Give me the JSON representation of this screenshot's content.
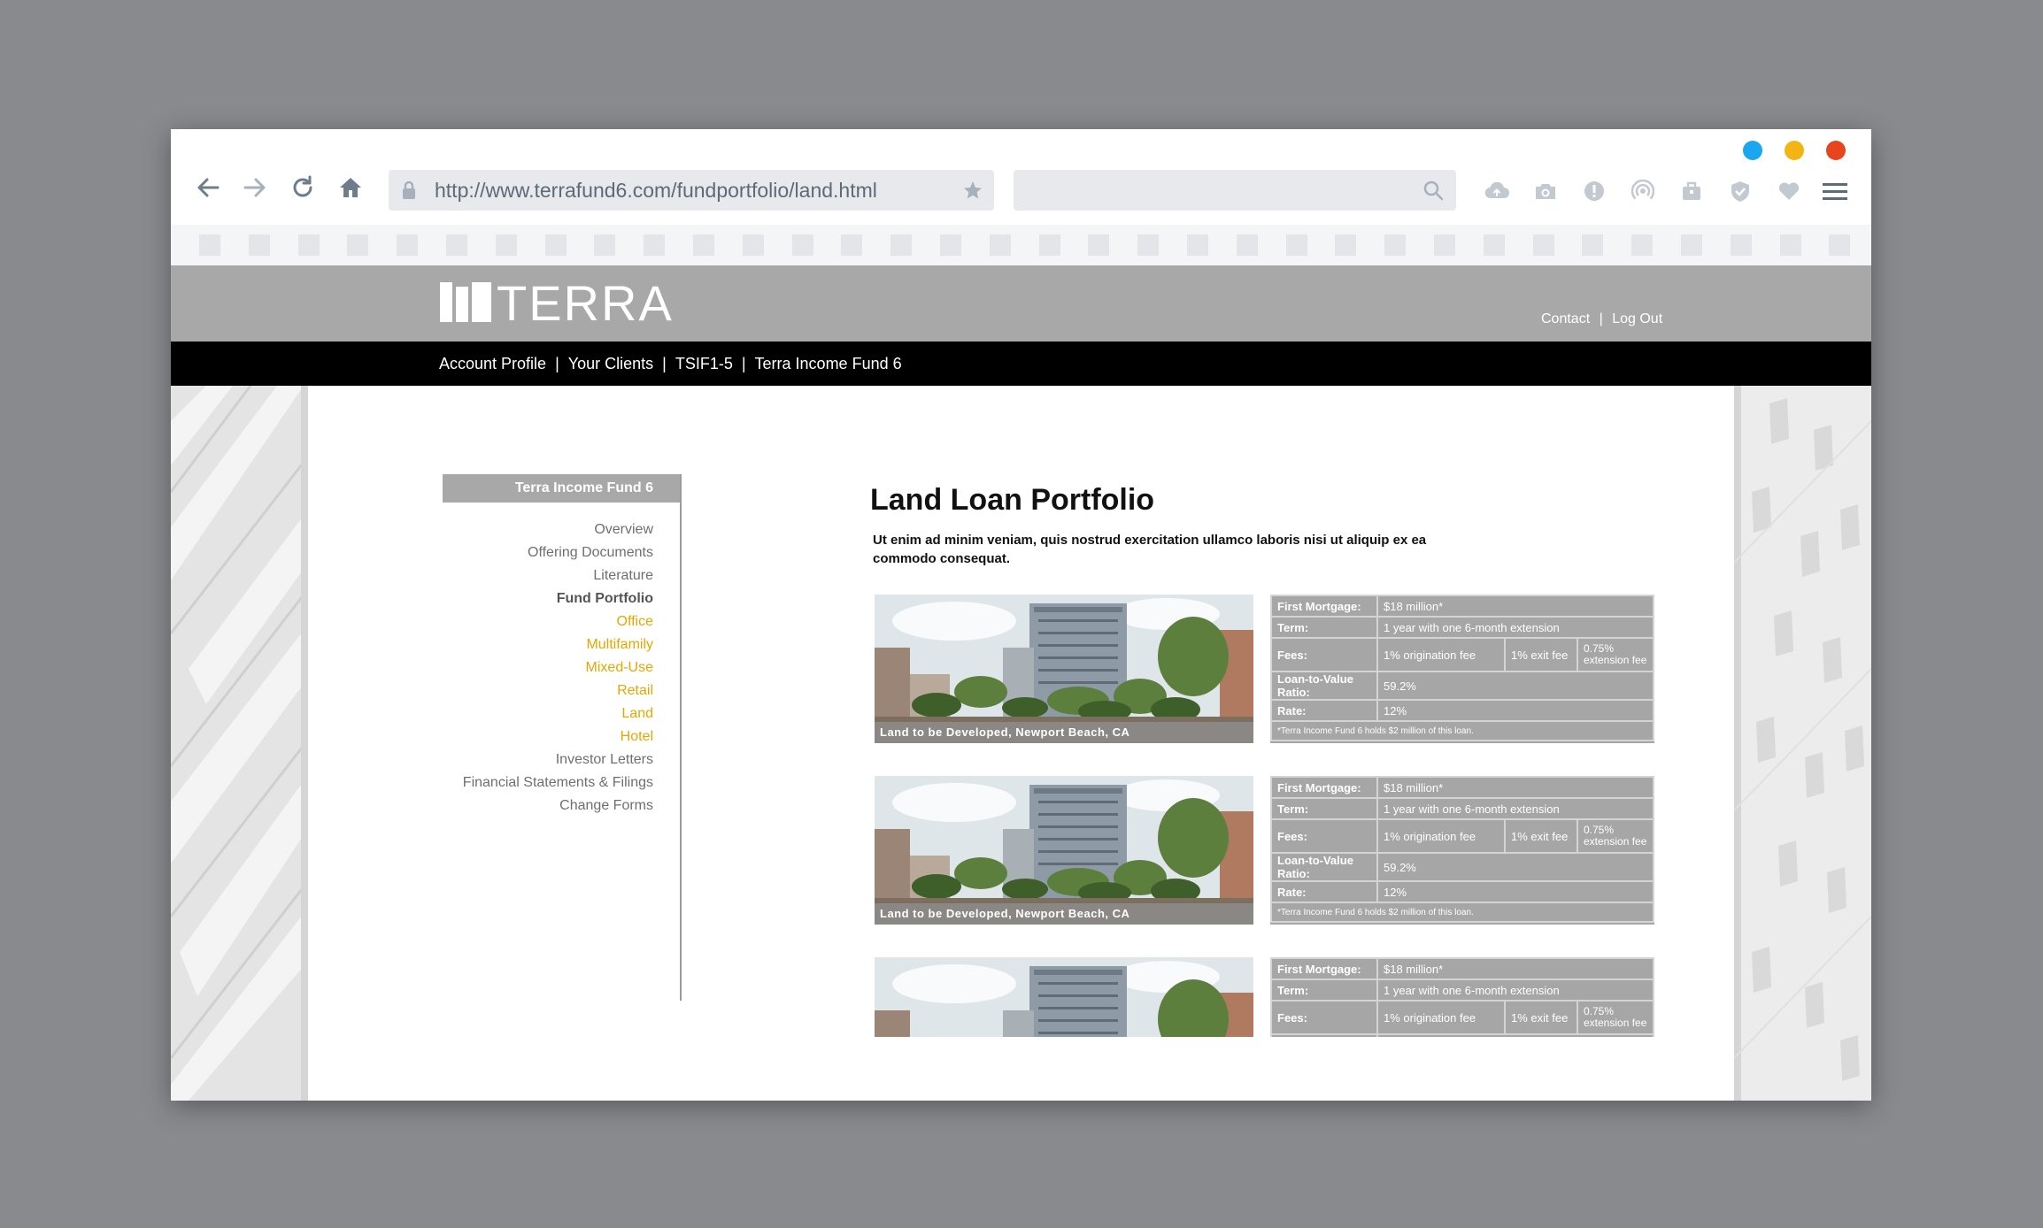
{
  "browser": {
    "url": "http://www.terrafund6.com/fundportfolio/land.html",
    "search_placeholder": "",
    "window_dots": [
      "#1aa7ef",
      "#f4b514",
      "#e6451d"
    ],
    "toolbar_icons": [
      "cloud-upload-icon",
      "camera-icon",
      "alert-icon",
      "broadcast-icon",
      "briefcase-icon",
      "shield-icon",
      "heart-icon",
      "menu-icon"
    ]
  },
  "site": {
    "logo": "TERRA",
    "utility_nav": [
      "Contact",
      "Log Out"
    ],
    "main_nav": [
      "Account Profile",
      "Your Clients",
      "TSIF1-5",
      "Terra Income Fund 6"
    ]
  },
  "sidebar": {
    "header": "Terra Income Fund 6",
    "items": [
      {
        "label": "Overview",
        "type": "normal"
      },
      {
        "label": "Offering Documents",
        "type": "normal"
      },
      {
        "label": "Literature",
        "type": "normal"
      },
      {
        "label": "Fund Portfolio",
        "type": "active"
      },
      {
        "label": "Office",
        "type": "sub"
      },
      {
        "label": "Multifamily",
        "type": "sub"
      },
      {
        "label": "Mixed-Use",
        "type": "sub"
      },
      {
        "label": "Retail",
        "type": "sub"
      },
      {
        "label": "Land",
        "type": "sub"
      },
      {
        "label": "Hotel",
        "type": "sub"
      },
      {
        "label": "Investor Letters",
        "type": "normal"
      },
      {
        "label": "Financial Statements & Filings",
        "type": "normal"
      },
      {
        "label": "Change Forms",
        "type": "normal"
      }
    ]
  },
  "main": {
    "title": "Land Loan Portfolio",
    "intro": "Ut enim ad minim veniam, quis nostrud exercitation ullamco laboris nisi ut aliquip ex ea commodo consequat.",
    "accent_color": "#e8a600",
    "loans": [
      {
        "caption": "Land to be Developed, Newport Beach, CA",
        "first_mortgage_label": "First Mortgage:",
        "first_mortgage": "$18 million*",
        "term_label": "Term:",
        "term": "1 year with one 6-month extension",
        "fees_label": "Fees:",
        "fee1": "1% origination fee",
        "fee2": "1% exit fee",
        "fee3": "0.75% extension fee",
        "ltv_label": "Loan-to-Value Ratio:",
        "ltv": "59.2%",
        "rate_label": "Rate:",
        "rate": "12%",
        "note": "*Terra Income Fund 6 holds $2 million of this loan."
      },
      {
        "caption": "Land to be Developed, Newport Beach, CA",
        "first_mortgage_label": "First Mortgage:",
        "first_mortgage": "$18 million*",
        "term_label": "Term:",
        "term": "1 year with one 6-month extension",
        "fees_label": "Fees:",
        "fee1": "1% origination fee",
        "fee2": "1% exit fee",
        "fee3": "0.75% extension fee",
        "ltv_label": "Loan-to-Value Ratio:",
        "ltv": "59.2%",
        "rate_label": "Rate:",
        "rate": "12%",
        "note": "*Terra Income Fund 6 holds $2 million of this loan."
      },
      {
        "caption": "",
        "first_mortgage_label": "First Mortgage:",
        "first_mortgage": "$18 million*",
        "term_label": "Term:",
        "term": "1 year with one 6-month extension",
        "fees_label": "Fees:",
        "fee1": "1% origination fee",
        "fee2": "1% exit fee",
        "fee3": "0.75% extension fee",
        "ltv_label": "",
        "ltv": "",
        "rate_label": "",
        "rate": "",
        "note": ""
      }
    ]
  }
}
